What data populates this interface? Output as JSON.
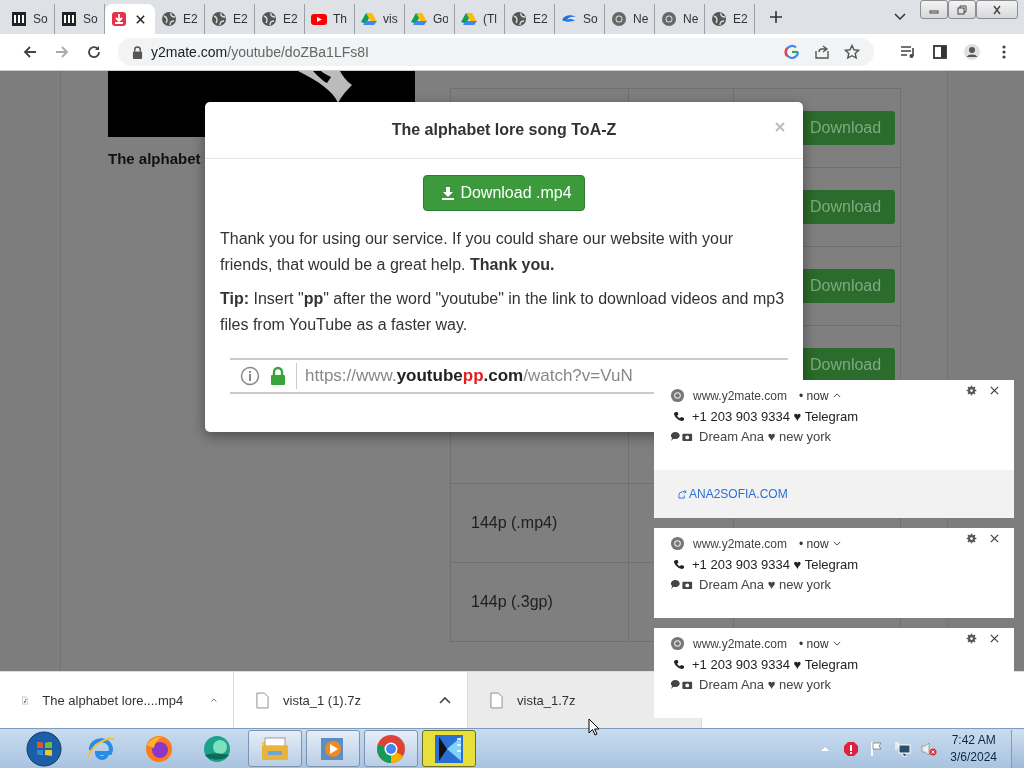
{
  "tabs": [
    {
      "kind": "museum",
      "label": "So",
      "selected": false
    },
    {
      "kind": "museum",
      "label": "So",
      "selected": false
    },
    {
      "kind": "download",
      "selected": true
    },
    {
      "kind": "globe",
      "label": "E2",
      "selected": false
    },
    {
      "kind": "globe",
      "label": "E2",
      "selected": false
    },
    {
      "kind": "globe",
      "label": "E2",
      "selected": false
    },
    {
      "kind": "youtube",
      "label": "Th",
      "selected": false
    },
    {
      "kind": "drive",
      "label": "vis",
      "selected": false
    },
    {
      "kind": "drive",
      "label": "Go",
      "selected": false
    },
    {
      "kind": "drive",
      "label": "(Tl",
      "selected": false
    },
    {
      "kind": "globe",
      "label": "E2",
      "selected": false
    },
    {
      "kind": "swirl",
      "label": "So",
      "selected": false
    },
    {
      "kind": "chrome",
      "label": "Ne",
      "selected": false
    },
    {
      "kind": "chrome",
      "label": "Ne",
      "selected": false
    },
    {
      "kind": "globe",
      "label": "E2",
      "selected": false
    }
  ],
  "address": {
    "host": "y2mate.com",
    "path": "/youtube/doZBa1LFs8I"
  },
  "page": {
    "video_title": "The alphabet",
    "rows": [
      {
        "button": "Download"
      },
      {
        "button": "Download"
      },
      {
        "button": "Download"
      },
      {
        "button": "Download"
      },
      {},
      {
        "quality": "144p (.mp4)"
      },
      {
        "quality": "144p (.3gp)"
      }
    ]
  },
  "modal": {
    "title": "The alphabet lore song ToA-Z",
    "button": "Download .mp4",
    "message": "Thank you for using our service. If you could share our website with your friends, that would be a great help. **Thank you.**",
    "tip": "**Tip:** Insert \"**pp**\" after the word \"youtube\" in the link to download videos and mp3 files from YouTube as a faster way.",
    "url_image": [
      {
        "text": "https://www.",
        "kind": "scheme"
      },
      {
        "text": "youtube",
        "kind": "domain"
      },
      {
        "text": "pp",
        "kind": "inserted"
      },
      {
        "text": ".com",
        "kind": "domain"
      },
      {
        "text": "/watch?v=VuN",
        "kind": "path"
      }
    ]
  },
  "notifications": [
    {
      "site": "www.y2mate.com",
      "time": "• now",
      "expanded": true,
      "phone": "+1 203 903 9334 ♥ Telegram",
      "contact": "Dream Ana ♥ new york",
      "link": "ANA2SOFIA.COM"
    },
    {
      "site": "www.y2mate.com",
      "time": "• now",
      "expanded": false,
      "phone": "+1 203 903 9334 ♥ Telegram",
      "contact": "Dream Ana ♥ new york"
    },
    {
      "site": "www.y2mate.com",
      "time": "• now",
      "expanded": false,
      "phone": "+1 203 903 9334 ♥ Telegram",
      "contact": "Dream Ana ♥ new york"
    }
  ],
  "downloads": [
    {
      "kind": "audio",
      "name": "The alphabet lore....mp4",
      "menu": true,
      "hovered": false
    },
    {
      "kind": "file",
      "name": "vista_1 (1).7z",
      "menu": true,
      "hovered": false
    },
    {
      "kind": "file",
      "name": "vista_1.7z",
      "menu": false,
      "hovered": true
    }
  ],
  "taskbar": {
    "apps": [
      {
        "kind": "ie",
        "running": false,
        "active": false
      },
      {
        "kind": "firefox",
        "running": false,
        "active": false
      },
      {
        "kind": "orb",
        "running": false,
        "active": false
      },
      {
        "kind": "folder",
        "running": true,
        "active": false
      },
      {
        "kind": "media",
        "running": true,
        "active": false
      },
      {
        "kind": "chrome",
        "running": true,
        "active": false
      },
      {
        "kind": "editor",
        "running": true,
        "active": true
      }
    ],
    "time": "7:42 AM",
    "date": "3/6/2024"
  }
}
